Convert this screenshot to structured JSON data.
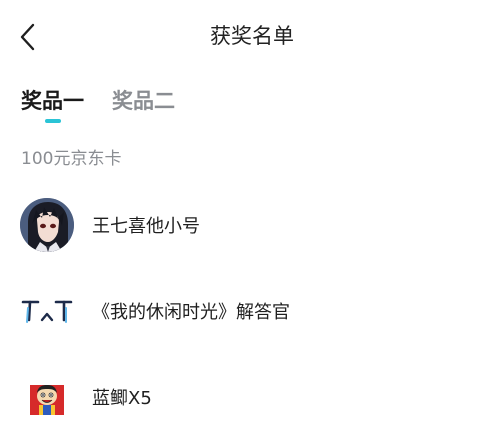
{
  "header": {
    "title": "获奖名单",
    "back_icon": "chevron-left-icon"
  },
  "tabs": [
    {
      "label": "奖品一",
      "active": true
    },
    {
      "label": "奖品二",
      "active": false
    }
  ],
  "accent_color": "#2bc4d6",
  "prize": {
    "name": "100元京东卡"
  },
  "winners": [
    {
      "name": "王七喜他小号",
      "avatar": "anime-boy-avatar"
    },
    {
      "name": "《我的休闲时光》解答官",
      "avatar": "crying-face-avatar"
    },
    {
      "name": "蓝鲫X5",
      "avatar": "cartoon-character-avatar"
    }
  ]
}
